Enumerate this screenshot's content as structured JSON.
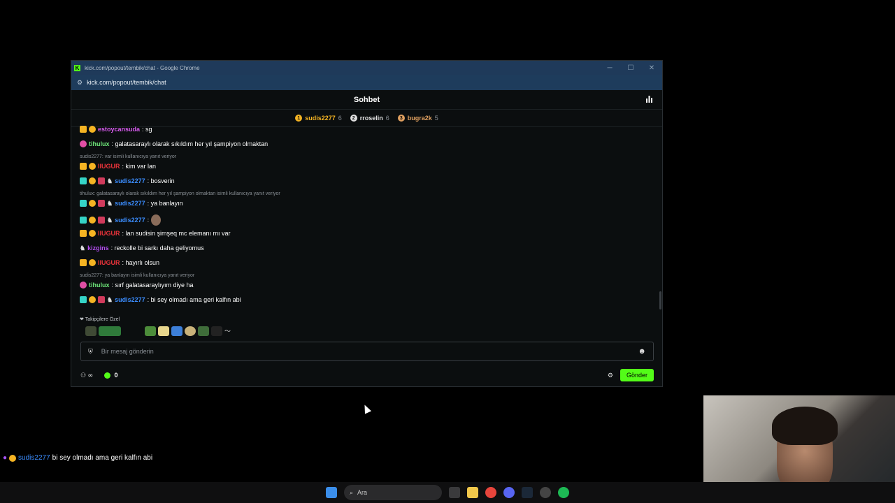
{
  "window": {
    "title": "kick.com/popout/tembik/chat - Google Chrome",
    "url": "kick.com/popout/tembik/chat"
  },
  "chat": {
    "title": "Sohbet",
    "gifters": [
      {
        "rank": "1",
        "name": "sudis2277",
        "count": "6",
        "color": "#f5b423"
      },
      {
        "rank": "2",
        "name": "rroselin",
        "count": "6",
        "color": "#e0e0e0"
      },
      {
        "rank": "3",
        "name": "bugra2k",
        "count": "5",
        "color": "#e0a060"
      }
    ],
    "messages": [
      {
        "user": "estoycansuda",
        "text": ": sg",
        "color": "#d95cf0"
      },
      {
        "user": "tihulux",
        "text": ": galatasaraylı olarak sıkıldım her yıl şampiyon olmaktan",
        "color": "#6ee87a"
      },
      {
        "reply": "sudis2277: var isimli kullanıcıya yanıt veriyor"
      },
      {
        "user": "IIUGUR",
        "text": ": kim var lan",
        "color": "#e8333a"
      },
      {
        "user": "sudis2277",
        "text": ": bosverin",
        "color": "#3b8dff"
      },
      {
        "reply": "tihulux: galatasaraylı olarak sıkıldım her yıl şampiyon olmaktan isimli kullanıcıya yanıt veriyor"
      },
      {
        "user": "sudis2277",
        "text": ": ya banlayın",
        "color": "#3b8dff"
      },
      {
        "user": "sudis2277",
        "text": ":",
        "color": "#3b8dff"
      },
      {
        "user": "IIUGUR",
        "text": ": lan sudisin şimşeq mc elemanı mı var",
        "color": "#e8333a"
      },
      {
        "user": "kizgins",
        "text": ": reckolle bi sarkı daha geliyomus",
        "color": "#b44ff0"
      },
      {
        "user": "IIUGUR",
        "text": ": hayırlı olsun",
        "color": "#e8333a"
      },
      {
        "reply": "sudis2277: ya banlayın isimli kullanıcıya yanıt veriyor"
      },
      {
        "user": "tihulux",
        "text": ": sırf galatasaraylıyım diye ha",
        "color": "#6ee87a"
      },
      {
        "user": "sudis2277",
        "text": ": bi sey olmadı ama geri kalfın abi",
        "color": "#3b8dff"
      }
    ],
    "follower_label": "Takipçilere Özel",
    "input_placeholder": "Bir mesaj gönderin",
    "viewer_count": "0",
    "send_label": "Gönder",
    "infinity": "∞"
  },
  "overlay": {
    "user": "sudis2277",
    "text": "bi sey olmadı ama geri kalfın abi"
  },
  "taskbar": {
    "search_label": "Ara"
  }
}
